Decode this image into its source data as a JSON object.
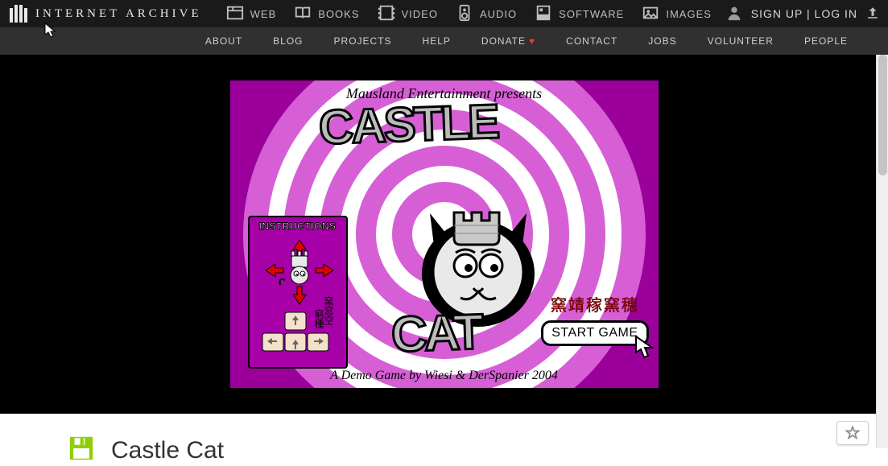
{
  "brand": {
    "name": "INTERNET ARCHIVE"
  },
  "media": {
    "web": {
      "label": "WEB"
    },
    "books": {
      "label": "BOOKS"
    },
    "video": {
      "label": "VIDEO"
    },
    "audio": {
      "label": "AUDIO"
    },
    "software": {
      "label": "SOFTWARE"
    },
    "images": {
      "label": "IMAGES"
    }
  },
  "auth": {
    "signup": "SIGN UP",
    "sep": " | ",
    "login": "LOG IN"
  },
  "subnav": {
    "about": "ABOUT",
    "blog": "BLOG",
    "projects": "PROJECTS",
    "help": "HELP",
    "donate": "DONATE",
    "contact": "CONTACT",
    "jobs": "JOBS",
    "volunteer": "VOLUNTEER",
    "people": "PEOPLE",
    "heart": "♥"
  },
  "game": {
    "presents": "Mausland Entertainment presents",
    "title_line1": "CASTLE",
    "title_line2": "CAT",
    "credit": "A Demo Game by Wiesi & DerSpanier 2004",
    "instructions_label": "INSTRUCTIONS",
    "cjk_instructions_1": "窯窓空",
    "cjk_instructions_2": "窮種",
    "cjk_start": "窯靖稼窯穂",
    "start_label": "START GAME"
  },
  "page": {
    "title": "Castle Cat"
  }
}
